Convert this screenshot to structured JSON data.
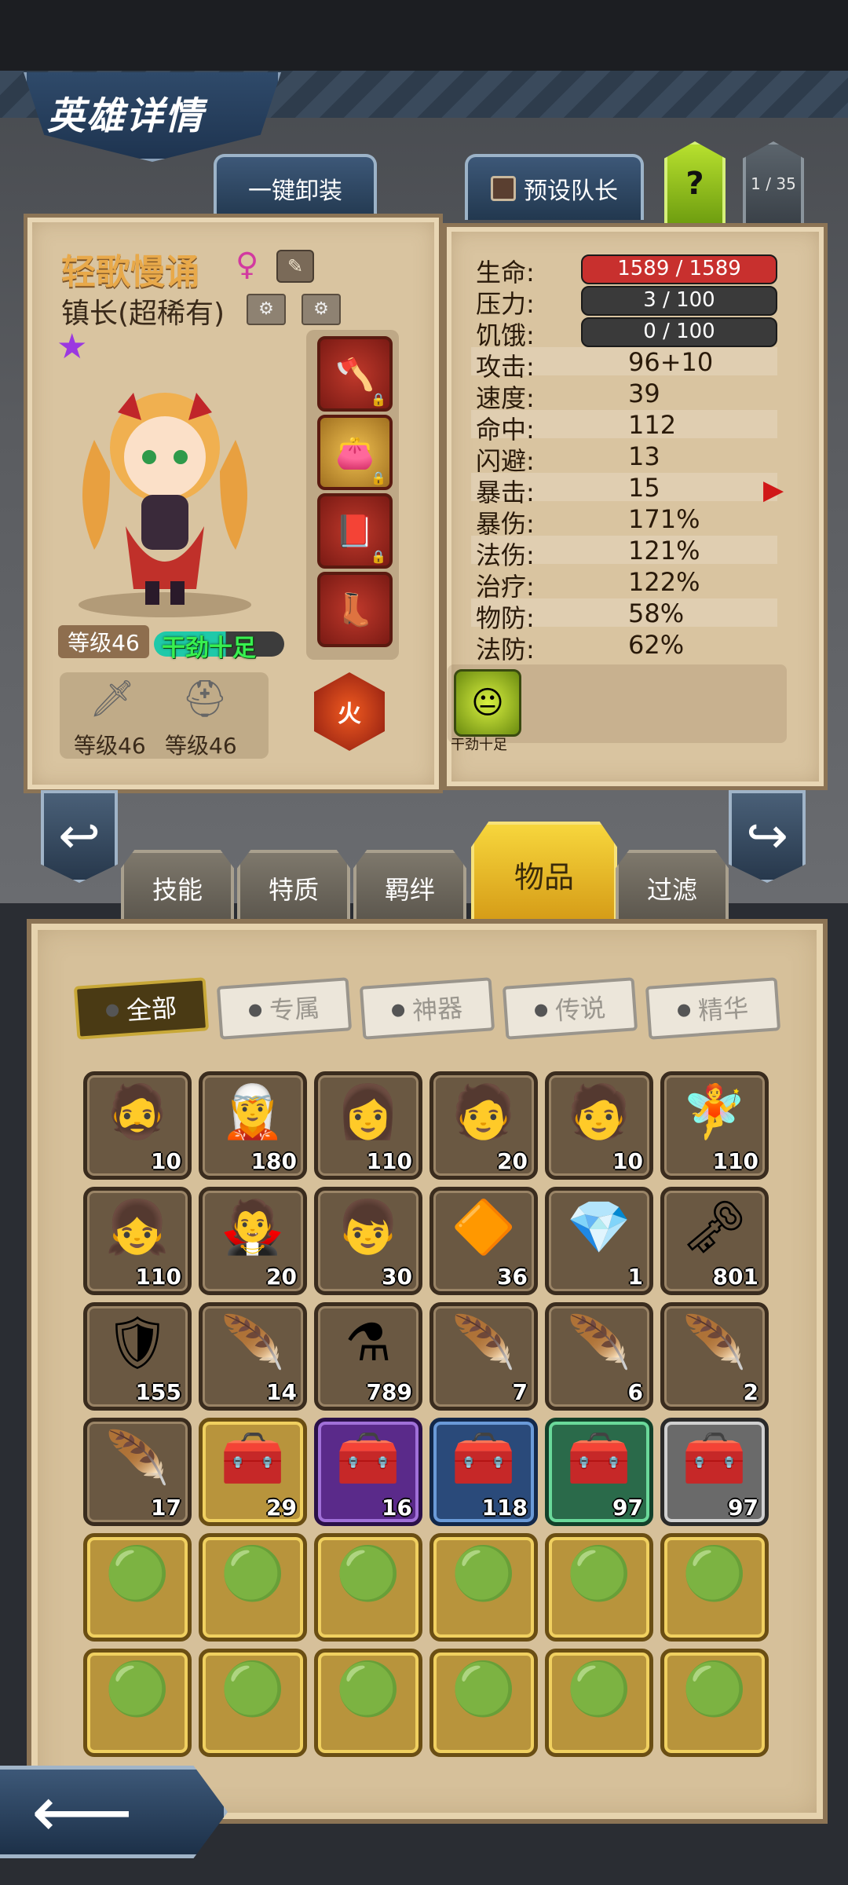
{
  "header": {
    "title": "英雄详情"
  },
  "top_buttons": {
    "unequip_all": "一键卸装",
    "preset_leader": "预设队长",
    "help": "?",
    "pager": "1 / 35"
  },
  "hero": {
    "name": "轻歌慢诵",
    "gender_icon": "female-symbol-icon",
    "title": "镇长(超稀有)",
    "rarity_stars": 1,
    "level": "等级46",
    "mood": "干劲十足",
    "weapon_level": "等级46",
    "armor_level": "等级46",
    "element": "火"
  },
  "stats": [
    {
      "label": "生命:",
      "value": "1589 / 1589",
      "type": "bar",
      "color": "#c8302e"
    },
    {
      "label": "压力:",
      "value": "3 / 100",
      "type": "bar",
      "color": "#3a3a3a"
    },
    {
      "label": "饥饿:",
      "value": "0 / 100",
      "type": "bar",
      "color": "#3a3a3a"
    },
    {
      "label": "攻击:",
      "value": "96+10"
    },
    {
      "label": "速度:",
      "value": "39"
    },
    {
      "label": "命中:",
      "value": "112"
    },
    {
      "label": "闪避:",
      "value": "13"
    },
    {
      "label": "暴击:",
      "value": "15"
    },
    {
      "label": "暴伤:",
      "value": "171%"
    },
    {
      "label": "法伤:",
      "value": "121%"
    },
    {
      "label": "治疗:",
      "value": "122%"
    },
    {
      "label": "物防:",
      "value": "58%"
    },
    {
      "label": "法防:",
      "value": "62%"
    }
  ],
  "trait": {
    "label": "干劲十足"
  },
  "tabs": [
    {
      "label": "技能",
      "active": false
    },
    {
      "label": "特质",
      "active": false
    },
    {
      "label": "羁绊",
      "active": false
    },
    {
      "label": "物品",
      "active": true
    },
    {
      "label": "过滤",
      "active": false
    }
  ],
  "filters": [
    {
      "label": "全部",
      "active": true
    },
    {
      "label": "专属",
      "active": false
    },
    {
      "label": "神器",
      "active": false
    },
    {
      "label": "传说",
      "active": false
    },
    {
      "label": "精华",
      "active": false
    }
  ],
  "inventory": [
    {
      "icon": "hero-portrait-icon",
      "glyph": "🧔",
      "count": "10",
      "frame": "normal"
    },
    {
      "icon": "hero-portrait-icon",
      "glyph": "🧝",
      "count": "180",
      "frame": "normal"
    },
    {
      "icon": "hero-portrait-icon",
      "glyph": "👩",
      "count": "110",
      "frame": "normal"
    },
    {
      "icon": "hero-portrait-icon",
      "glyph": "🧑",
      "count": "20",
      "frame": "normal"
    },
    {
      "icon": "hero-portrait-icon",
      "glyph": "🧑",
      "count": "10",
      "frame": "normal"
    },
    {
      "icon": "hero-portrait-icon",
      "glyph": "🧚",
      "count": "110",
      "frame": "normal"
    },
    {
      "icon": "hero-portrait-icon",
      "glyph": "👧",
      "count": "110",
      "frame": "normal"
    },
    {
      "icon": "hero-portrait-icon",
      "glyph": "🧛",
      "count": "20",
      "frame": "normal"
    },
    {
      "icon": "hero-portrait-icon",
      "glyph": "👦",
      "count": "30",
      "frame": "normal"
    },
    {
      "icon": "orange-gem-icon",
      "glyph": "🔶",
      "count": "36",
      "frame": "normal"
    },
    {
      "icon": "rainbow-crystal-icon",
      "glyph": "💎",
      "count": "1",
      "frame": "normal"
    },
    {
      "icon": "golden-key-icon",
      "glyph": "🗝",
      "count": "801",
      "frame": "normal"
    },
    {
      "icon": "cyan-emblem-icon",
      "glyph": "🛡",
      "count": "155",
      "frame": "normal"
    },
    {
      "icon": "phoenix-feather-icon",
      "glyph": "🪶",
      "count": "14",
      "frame": "normal"
    },
    {
      "icon": "potion-icon",
      "glyph": "⚗",
      "count": "789",
      "frame": "normal"
    },
    {
      "icon": "green-feather-icon",
      "glyph": "🪶",
      "count": "7",
      "frame": "normal"
    },
    {
      "icon": "purple-feather-icon",
      "glyph": "🪶",
      "count": "6",
      "frame": "normal"
    },
    {
      "icon": "blue-feather-icon",
      "glyph": "🪶",
      "count": "2",
      "frame": "normal"
    },
    {
      "icon": "white-feather-icon",
      "glyph": "🪶",
      "count": "17",
      "frame": "normal"
    },
    {
      "icon": "treasure-chest-icon",
      "glyph": "🧰",
      "count": "29",
      "frame": "gold"
    },
    {
      "icon": "treasure-chest-icon",
      "glyph": "🧰",
      "count": "16",
      "frame": "purple"
    },
    {
      "icon": "treasure-chest-icon",
      "glyph": "🧰",
      "count": "118",
      "frame": "blue"
    },
    {
      "icon": "treasure-chest-icon",
      "glyph": "🧰",
      "count": "97",
      "frame": "green"
    },
    {
      "icon": "treasure-chest-icon",
      "glyph": "🧰",
      "count": "97",
      "frame": "silver"
    },
    {
      "icon": "green-orb-icon",
      "glyph": "🟢",
      "count": "",
      "frame": "gold"
    },
    {
      "icon": "green-orb-icon",
      "glyph": "🟢",
      "count": "",
      "frame": "gold"
    },
    {
      "icon": "green-orb-icon",
      "glyph": "🟢",
      "count": "",
      "frame": "gold"
    },
    {
      "icon": "green-orb-icon",
      "glyph": "🟢",
      "count": "",
      "frame": "gold"
    },
    {
      "icon": "green-orb-icon",
      "glyph": "🟢",
      "count": "",
      "frame": "gold"
    },
    {
      "icon": "green-orb-icon",
      "glyph": "🟢",
      "count": "",
      "frame": "gold"
    },
    {
      "icon": "green-orb-icon",
      "glyph": "🟢",
      "count": "",
      "frame": "gold"
    },
    {
      "icon": "green-orb-icon",
      "glyph": "🟢",
      "count": "",
      "frame": "gold"
    },
    {
      "icon": "green-orb-icon",
      "glyph": "🟢",
      "count": "",
      "frame": "gold"
    },
    {
      "icon": "green-orb-icon",
      "glyph": "🟢",
      "count": "",
      "frame": "gold"
    },
    {
      "icon": "green-orb-icon",
      "glyph": "🟢",
      "count": "",
      "frame": "gold"
    },
    {
      "icon": "green-orb-icon",
      "glyph": "🟢",
      "count": "",
      "frame": "gold"
    }
  ]
}
